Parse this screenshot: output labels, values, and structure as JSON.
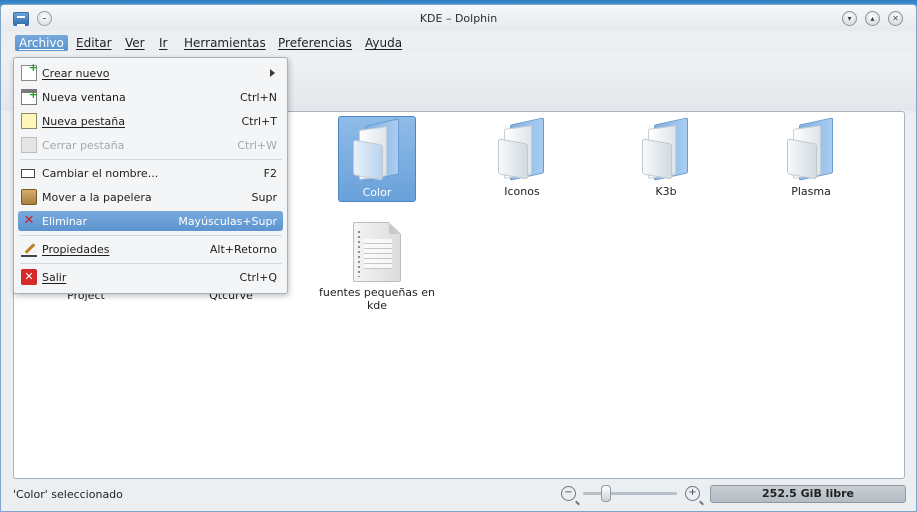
{
  "window": {
    "title": "KDE – Dolphin"
  },
  "menubar": [
    {
      "label": "Archivo"
    },
    {
      "label": "Editar"
    },
    {
      "label": "Ver"
    },
    {
      "label": "Ir"
    },
    {
      "label": "Herramientas"
    },
    {
      "label": "Preferencias"
    },
    {
      "label": "Ayuda"
    }
  ],
  "dropdown": {
    "items": [
      {
        "label": "Crear nuevo",
        "shortcut": "",
        "icon": "new-document-icon",
        "submenu": true
      },
      {
        "label": "Nueva ventana",
        "shortcut": "Ctrl+N",
        "icon": "new-window-icon"
      },
      {
        "label": "Nueva pestaña",
        "shortcut": "Ctrl+T",
        "icon": "new-tab-icon"
      },
      {
        "label": "Cerrar pestaña",
        "shortcut": "Ctrl+W",
        "icon": "close-tab-icon",
        "disabled": true
      },
      {
        "label": "Cambiar el nombre...",
        "shortcut": "F2",
        "icon": "rename-icon"
      },
      {
        "label": "Mover a la papelera",
        "shortcut": "Supr",
        "icon": "trash-icon"
      },
      {
        "label": "Eliminar",
        "shortcut": "Mayúsculas+Supr",
        "icon": "delete-icon",
        "active": true
      },
      {
        "label": "Propiedades",
        "shortcut": "Alt+Retorno",
        "icon": "properties-icon"
      },
      {
        "label": "Salir",
        "shortcut": "Ctrl+Q",
        "icon": "quit-icon"
      }
    ]
  },
  "files": [
    {
      "name": "Color",
      "type": "folder",
      "selected": true
    },
    {
      "name": "Iconos",
      "type": "folder"
    },
    {
      "name": "K3b",
      "type": "folder"
    },
    {
      "name": "Plasma",
      "type": "folder"
    },
    {
      "name": "Project",
      "type": "folder"
    },
    {
      "name": "Qtcurve",
      "type": "folder"
    },
    {
      "name": "fuentes pequeñas en kde",
      "type": "document"
    }
  ],
  "status": {
    "message": "'Color' seleccionado",
    "free_space": "252.5 GiB libre"
  },
  "colors": {
    "selection": "#6aa1da",
    "menu_highlight": "#5c94cf",
    "folder_blue": "#7fb0e3"
  }
}
